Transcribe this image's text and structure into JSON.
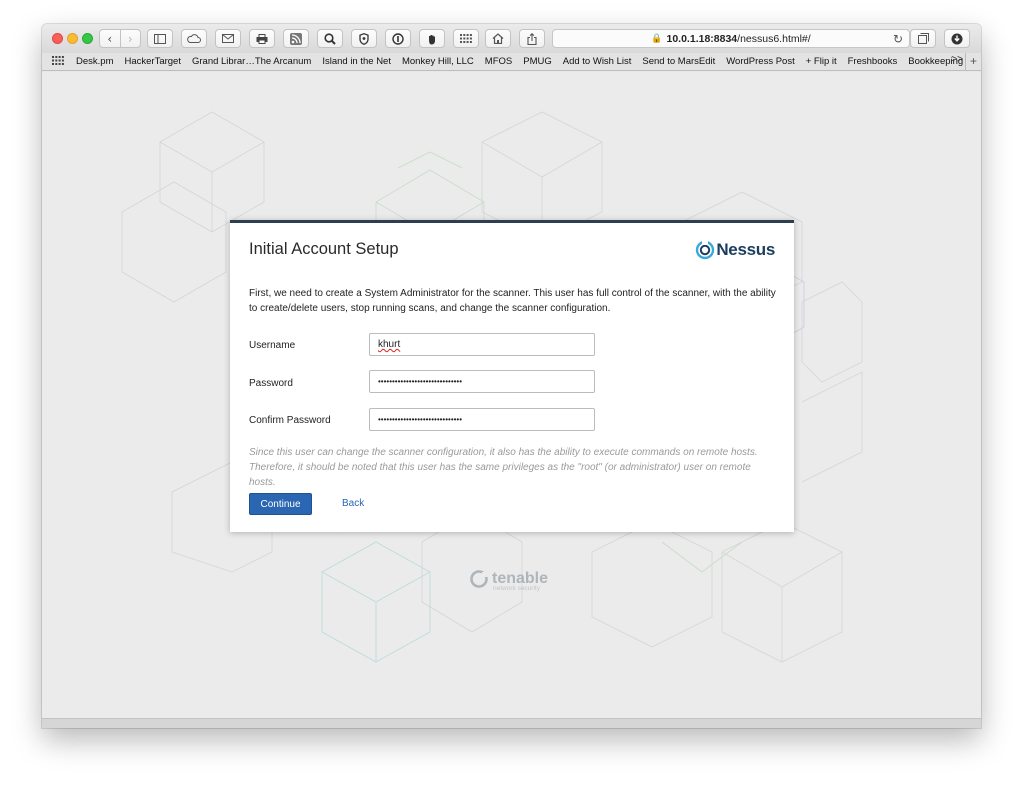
{
  "browser": {
    "url_host": "10.0.1.18:8834",
    "url_path": "/nessus6.html#/",
    "bookmarks": [
      "Desk.pm",
      "HackerTarget",
      "Grand Librar…The Arcanum",
      "Island in the Net",
      "Monkey Hill, LLC",
      "MFOS",
      "PMUG",
      "Add to Wish List",
      "Send to MarsEdit",
      "WordPress Post",
      "+ Flip it",
      "Freshbooks",
      "Bookkeeping"
    ],
    "bookmarks_more": ">>",
    "bookmarks_add": "+"
  },
  "dialog": {
    "title": "Initial Account Setup",
    "logo_text": "Nessus",
    "description": "First, we need to create a System Administrator for the scanner. This user has full control of the scanner, with the ability to create/delete users, stop running scans, and change the scanner configuration.",
    "fields": {
      "username": {
        "label": "Username",
        "value": "khurt"
      },
      "password": {
        "label": "Password",
        "value": "••••••••••••••••••••••••••••••"
      },
      "confirm": {
        "label": "Confirm Password",
        "value": "••••••••••••••••••••••••••••••"
      }
    },
    "note": "Since this user can change the scanner configuration, it also has the ability to execute commands on remote hosts. Therefore, it should be noted that this user has the same privileges as the \"root\" (or administrator) user on remote hosts.",
    "continue_label": "Continue",
    "back_label": "Back"
  },
  "footer_brand": {
    "name": "tenable",
    "tagline": "network security"
  },
  "colors": {
    "accent": "#2a66b2",
    "modal_border": "#2c3e50",
    "logo": "#1b3d5e"
  }
}
